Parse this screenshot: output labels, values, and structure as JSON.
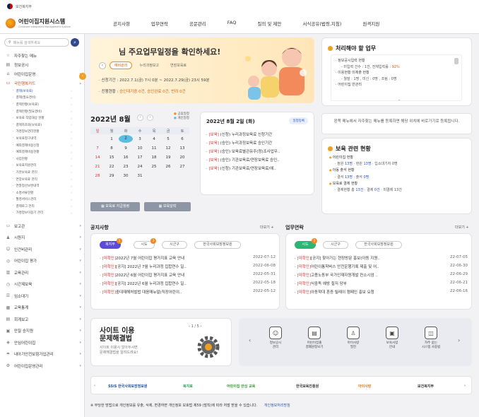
{
  "gov": {
    "label": "보건복지부"
  },
  "header": {
    "logo_title": "어린이집지원시스템",
    "logo_sub": "Childcare Integrated Management System",
    "nav": [
      "공지사항",
      "업무연락",
      "공문관리",
      "FAQ",
      "질의 및 제안",
      "서식공유(법령,지침)",
      "원격지원"
    ]
  },
  "sidebar": {
    "search_placeholder": "메뉴를 검색하세요",
    "top_items": [
      "자주찾는 메뉴",
      "정보공시",
      "어린이집운영",
      "국민행복카드"
    ],
    "sub_items": [
      "결제(보육료)",
      "결제(필요경비)",
      "결제현황(보육료)",
      "결제현황(필요경비)",
      "보육료 작업대상 현황",
      "결제자조회(보육료)",
      "가명정보관리현황",
      "보육료청구내역",
      "예외결제비용신청",
      "예외결제비용현황",
      "사업현황",
      "보육료지원관리",
      "기관보육료 관리",
      "연장보육료 관리",
      "연말정산보완내역",
      "소명서류현황",
      "월영서비스관리",
      "결제로그 관리",
      "가명정보이용기 관리"
    ],
    "lower_items": [
      "보고관",
      "시원지",
      "인건비관리",
      "어린이집 평가",
      "교육관리",
      "시간제보육",
      "임소대기",
      "교육통계",
      "회계보고",
      "만질 승지원",
      "안심어린이집",
      "내아기안전보험가입관리",
      "어린이집운영관리"
    ]
  },
  "banner": {
    "title": "님 주요업무일정을 확인하세요!",
    "tabs": [
      "예비관리",
      "누리과정보고",
      "연장보육료"
    ],
    "line1_prefix": "· 신청기간 : 2022.7.1(금) 7시 0분 ~ 2022.7.29(금) 23시 59분",
    "line2_prefix": "· 진행현황 : ",
    "line2_value": "승인대기중 0건, 승인완료 0건, 반려 0건"
  },
  "todo": {
    "title": "처리해야 할 업무",
    "lines": [
      "· 정보공시입력 현황",
      "- 미입력 건수 : 1건, 전체입력률 : ",
      "92%",
      "· 이용현황 미제출 현황",
      "- 월말 : 1명 , 미신 : 0명 , 조림 : 0명",
      "· 어린이집 반관리"
    ]
  },
  "calendar": {
    "month_title": "2022년 8월",
    "legend": [
      "공휴일정",
      "개인일정"
    ],
    "weekdays": [
      "일",
      "월",
      "화",
      "수",
      "목",
      "금",
      "토"
    ],
    "weeks": [
      [
        "",
        "1",
        "2",
        "3",
        "4",
        "5",
        "6"
      ],
      [
        "7",
        "8",
        "9",
        "10",
        "11",
        "12",
        "13"
      ],
      [
        "14",
        "15",
        "16",
        "17",
        "18",
        "19",
        "20"
      ],
      [
        "21",
        "22",
        "23",
        "24",
        "25",
        "26",
        "27"
      ],
      [
        "28",
        "29",
        "30",
        "31",
        "",
        "",
        ""
      ]
    ],
    "today": "2",
    "btn1": "보육료 지급월령",
    "btn2": "보육달력"
  },
  "dayplan": {
    "title": "2022년 8월 2일 (화)",
    "badge": "일정등록",
    "items": [
      {
        "tag": "[보육]",
        "text": "(신청) 누리과정보육료 신청기간"
      },
      {
        "tag": "[보육]",
        "text": "(승인) 누리과정보육료 승인기간"
      },
      {
        "tag": "[보육]",
        "text": "(승인) 보육료별관유주(청)조사업무.."
      },
      {
        "tag": "[보육]",
        "text": "(승인) 기관보육료/연장보육료 승인.."
      },
      {
        "tag": "[보육]",
        "text": "(신청) 기관보육료/연장보육료/예.."
      }
    ]
  },
  "guide": {
    "text": "왼쪽 메뉴에서 자주찾는 메뉴를 등록하면 해당 위치에 바로가기로 등록됩니다."
  },
  "care": {
    "title": "보육 관련 현황",
    "lines": [
      {
        "kind": "h",
        "text": "어린이집 현황"
      },
      {
        "kind": "s",
        "text": "· 정원 ",
        "v1": "13명",
        "m": " · 현원 ",
        "v2": "13명",
        "r": " · 입소대기자 0명"
      },
      {
        "kind": "h",
        "text": "아동 출석 현황"
      },
      {
        "kind": "s",
        "text": "· 결석 ",
        "v1": "13명",
        "m": " · 출석 ",
        "v2": "0명",
        "r": ""
      },
      {
        "kind": "h",
        "text": "보육료 결제 현황"
      },
      {
        "kind": "s",
        "text": "· 결제현황 총 ",
        "v1": "13건",
        "m": " · 결제 ",
        "v2": "0건",
        "r": " · 미결제 13건"
      }
    ]
  },
  "notice": {
    "title": "공지사항",
    "more": "더보기 +",
    "tabs": [
      {
        "label": "복지부",
        "count": "5"
      },
      {
        "label": "시도",
        "count": "3"
      },
      {
        "label": "시군구",
        "count": ""
      },
      {
        "label": "한국사회보장정보원",
        "count": ""
      }
    ],
    "rows": [
      {
        "tag": "[미확인]",
        "text": "2022년 7월 어린이집 평가지표 교육 안내",
        "date": "2022-07-12"
      },
      {
        "tag": "[미확인]",
        "text": "[공지] 2022년 7월 누리과정 집합연수 일..",
        "date": "2022-06-08"
      },
      {
        "tag": "[미확인]",
        "text": "2022년 6월 어린이집 평가지표 교육 안내",
        "date": "2022-05-31"
      },
      {
        "tag": "[미확인]",
        "text": "[공지] 2022년 6월 누리과정 집합연수 일..",
        "date": "2022-05-18"
      },
      {
        "tag": "[미확인]",
        "text": "중대재해처벌법 대응매뉴얼(직장어린이..",
        "date": "2022-05-12"
      }
    ]
  },
  "work": {
    "title": "업무연락",
    "more": "더보기 +",
    "tabs": [
      {
        "label": "시도",
        "count": "3"
      },
      {
        "label": "시군구",
        "count": ""
      },
      {
        "label": "한국사회보장정보원",
        "count": ""
      }
    ],
    "rows": [
      {
        "tag": "[미확인]",
        "text": "[공지] 찾아가는 현장방문 홍보(아동 지원..",
        "date": "22-07-05"
      },
      {
        "tag": "[미확인]",
        "text": "어린이통학버스 안전운행기록 제출 및 어..",
        "date": "22-06-30"
      },
      {
        "tag": "[미확인]",
        "text": "고용노동부 국가인재자원개발 컨소시엄 ..",
        "date": "22-06-29"
      },
      {
        "tag": "[미확인]",
        "text": "식중독 예방 철저 당부",
        "date": "22-06-21"
      },
      {
        "tag": "[미확인]",
        "text": "아동학대 혼증 릴레이 캠페인 홍보 요청",
        "date": "22-06-16"
      }
    ]
  },
  "help": {
    "title_line1": "사이트 이용",
    "title_line2": "문제해결법",
    "sub_line1": "사이트 이용시 알아두시면",
    "sub_line2": "문제해결법을 알려드려요!",
    "page": "1 / 5"
  },
  "quick": {
    "items": [
      {
        "icon": "☺",
        "label1": "정보공시",
        "label2": "관리"
      },
      {
        "icon": "▤",
        "label1": "어린이집출",
        "label2": "결폐원정보기"
      },
      {
        "icon": "♙",
        "label1": "아이사랑",
        "label2": "필진"
      },
      {
        "icon": "▣",
        "label1": "보육사업",
        "label2": "안내"
      },
      {
        "icon": "◫",
        "label1": "자주 묻는",
        "label2": "시스템 사용법"
      }
    ]
  },
  "partners": [
    "SSiS 한국사회보장정보원",
    "복지로",
    "어린이집 안심 교육",
    "한국보육진흥원",
    "아이사랑",
    "보건복지부"
  ],
  "footer": {
    "text": "※ 부당한 방법으로 개인정보를 유출, 삭제, 변경하면 개인정보 보호법 제59 (벌칙)에 따라 처벌 받을 수 있습니다.",
    "link": "개인정보처리방침"
  },
  "colors": {
    "accent": "#f0a020",
    "brand_blue": "#2e4a8a",
    "notice_tab": "#5a4bd8",
    "work_tab": "#2bb673",
    "alert_red": "#dd3333"
  }
}
